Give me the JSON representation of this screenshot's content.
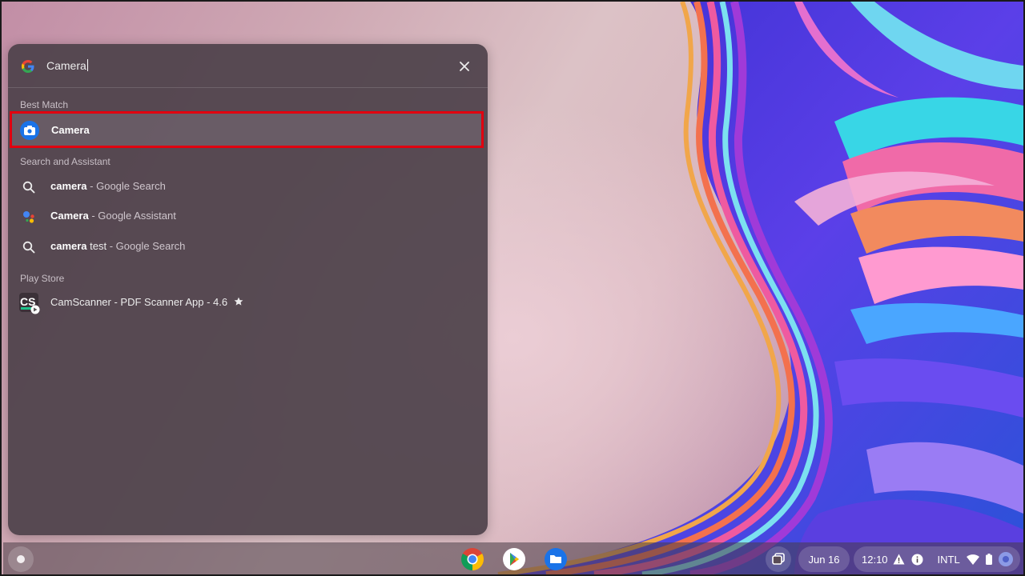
{
  "search": {
    "query": "Camera"
  },
  "sections": {
    "best_match": "Best Match",
    "search_assistant": "Search and Assistant",
    "play_store": "Play Store"
  },
  "best_match": {
    "label": "Camera",
    "icon": "camera-app-icon"
  },
  "results": [
    {
      "bold": "camera",
      "suffix": " - Google Search",
      "icon": "search-icon"
    },
    {
      "bold": "Camera",
      "suffix": " - Google Assistant",
      "icon": "google-assistant-icon"
    },
    {
      "bold": "camera",
      "rest": " test",
      "suffix": " - Google Search",
      "icon": "search-icon"
    }
  ],
  "play_store_result": {
    "label": "CamScanner - PDF Scanner App - 4.6",
    "icon": "camscanner-icon",
    "rating_icon": "star-icon"
  },
  "shelf": {
    "apps": [
      "chrome-icon",
      "play-store-icon",
      "files-icon"
    ],
    "date": "Jun 16",
    "time": "12:10",
    "ime": "INTL"
  },
  "colors": {
    "highlight_border": "#e1000f",
    "launcher_bg": "#4e424a",
    "camera_icon_blue": "#1a73e8"
  }
}
